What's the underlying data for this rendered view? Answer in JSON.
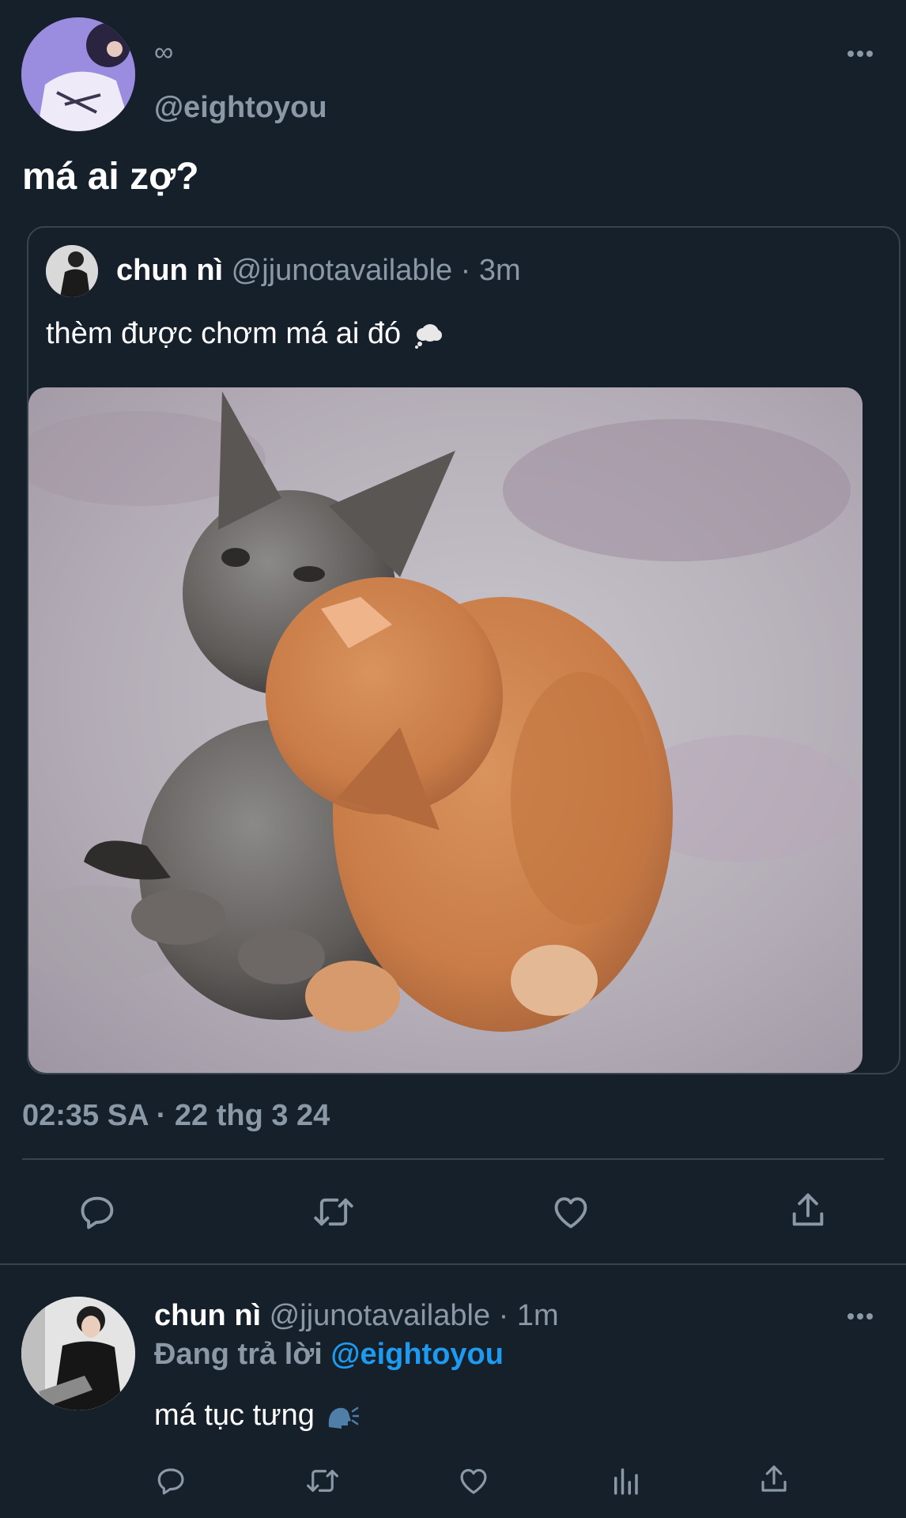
{
  "main_tweet": {
    "display_name": "∞",
    "handle": "@eightoyou",
    "text": "má ai zợ?",
    "timestamp": "02:35 SA · 22 thg 3 24",
    "more_icon": "more-horizontal-icon"
  },
  "quoted_tweet": {
    "display_name": "chun nì",
    "handle": "@jjunotavailable",
    "time": "· 3m",
    "text": "thèm được chơm má ai đó",
    "emoji": "thought-bubble-emoji",
    "image_alt": "two kittens, gray kitten nuzzling orange kitten"
  },
  "actions": {
    "icons": [
      "reply-icon",
      "retweet-icon",
      "like-icon",
      "share-icon"
    ]
  },
  "reply": {
    "display_name": "chun nì",
    "handle": "@jjunotavailable",
    "time": "· 1m",
    "replying_prefix": "Đang trả lời",
    "replying_to": "@eightoyou",
    "text": "má tục tưng",
    "emoji": "speaking-head-emoji",
    "icons": [
      "reply-icon",
      "retweet-icon",
      "like-icon",
      "analytics-icon",
      "share-icon"
    ]
  },
  "colors": {
    "background": "#15202b",
    "muted": "#8b98a5",
    "accent": "#1d9bf0",
    "divider": "#38444d"
  }
}
